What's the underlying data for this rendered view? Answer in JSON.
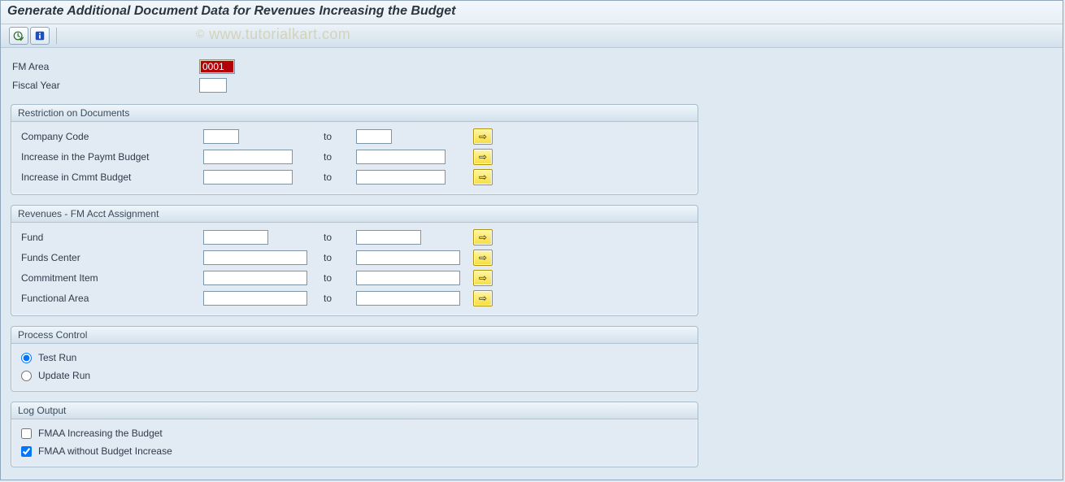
{
  "title": "Generate Additional Document Data for Revenues Increasing the Budget",
  "watermark": "www.tutorialkart.com",
  "toolbar": {
    "execute_icon": "execute",
    "info_icon": "info"
  },
  "top": {
    "fm_area_label": "FM Area",
    "fm_area_value": "0001",
    "fiscal_year_label": "Fiscal Year",
    "fiscal_year_value": ""
  },
  "groups": {
    "restrict": {
      "title": "Restriction on Documents",
      "rows": [
        {
          "label": "Company Code",
          "from": "",
          "to_label": "to",
          "to": ""
        },
        {
          "label": "Increase in the Paymt Budget",
          "from": "",
          "to_label": "to",
          "to": ""
        },
        {
          "label": "Increase in Cmmt Budget",
          "from": "",
          "to_label": "to",
          "to": ""
        }
      ]
    },
    "revenues": {
      "title": "Revenues - FM Acct Assignment",
      "rows": [
        {
          "label": "Fund",
          "from": "",
          "to_label": "to",
          "to": ""
        },
        {
          "label": "Funds Center",
          "from": "",
          "to_label": "to",
          "to": ""
        },
        {
          "label": "Commitment Item",
          "from": "",
          "to_label": "to",
          "to": ""
        },
        {
          "label": "Functional Area",
          "from": "",
          "to_label": "to",
          "to": ""
        }
      ]
    },
    "process": {
      "title": "Process Control",
      "radios": [
        {
          "label": "Test Run",
          "checked": true
        },
        {
          "label": "Update Run",
          "checked": false
        }
      ]
    },
    "log": {
      "title": "Log Output",
      "checks": [
        {
          "label": "FMAA Increasing the Budget",
          "checked": false
        },
        {
          "label": "FMAA without Budget Increase",
          "checked": true
        }
      ]
    }
  }
}
